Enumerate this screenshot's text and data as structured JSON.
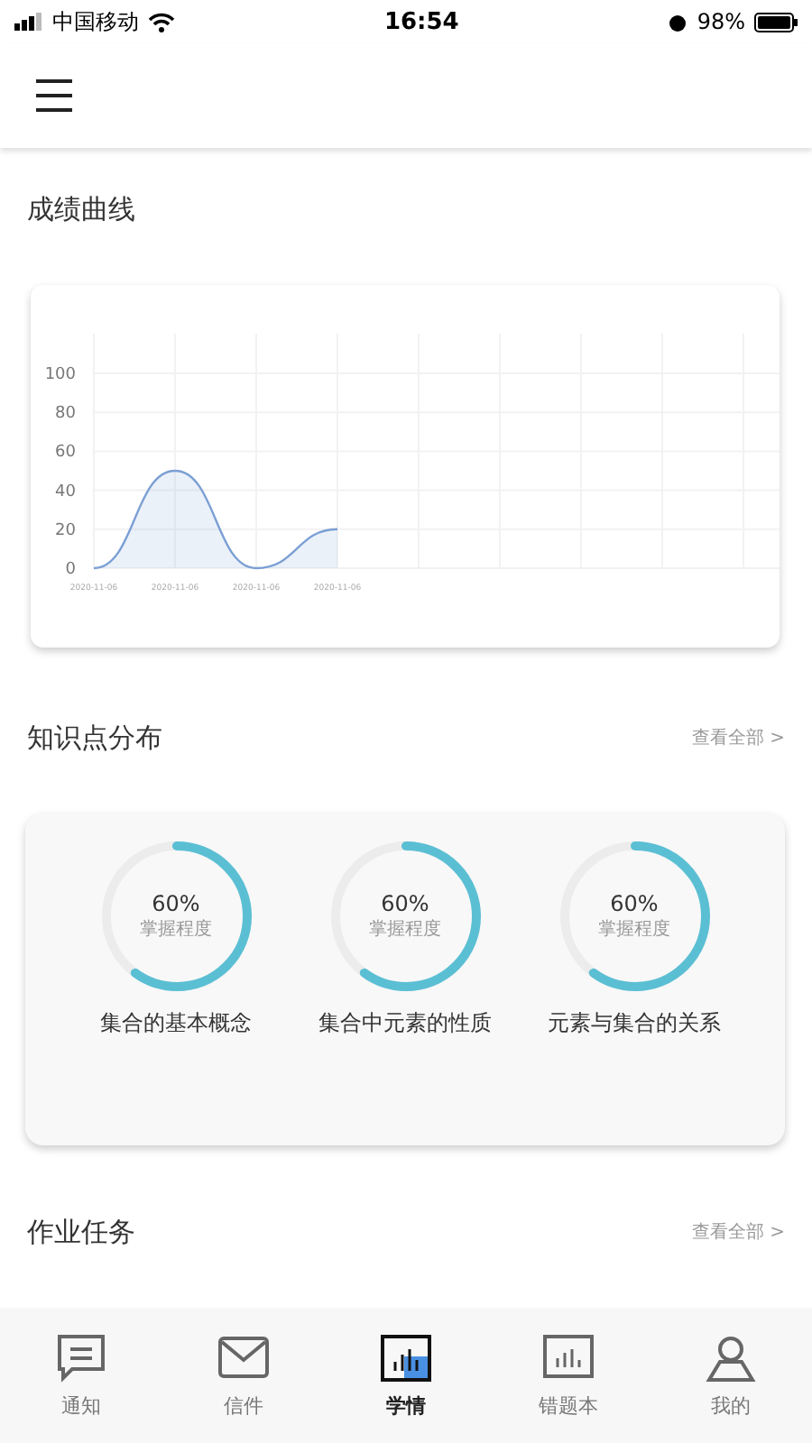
{
  "status_bar": {
    "carrier": "中国移动",
    "time": "16:54",
    "battery": "98%"
  },
  "score_section": {
    "title": "成绩曲线",
    "chart_data": {
      "type": "area",
      "categories": [
        "2020-11-06",
        "2020-11-06",
        "2020-11-06",
        "2020-11-06"
      ],
      "grid": true,
      "series": [
        {
          "color": "#7b9fd4",
          "values": [
            0,
            50,
            0,
            20
          ]
        }
      ],
      "ylim": [
        0,
        100
      ],
      "yticks": [
        0,
        20,
        40,
        60,
        80,
        100
      ]
    }
  },
  "knowledge_section": {
    "title": "知识点分布",
    "more": "查看全部 >",
    "items": [
      {
        "percent": "60%",
        "caption": "掌握程度",
        "name": "集合的基本概念",
        "level": 0.6
      },
      {
        "percent": "60%",
        "caption": "掌握程度",
        "name": "集合中元素的性质",
        "level": 0.6
      },
      {
        "percent": "60%",
        "caption": "掌握程度",
        "name": "元素与集合的关系",
        "level": 0.6
      }
    ]
  },
  "homework_section": {
    "title": "作业任务",
    "more": "查看全部 >"
  },
  "tab_bar": [
    {
      "label": "通知",
      "kind": "notice",
      "selected": false
    },
    {
      "label": "信件",
      "kind": "mail",
      "selected": false
    },
    {
      "label": "学情",
      "kind": "stats",
      "selected": true
    },
    {
      "label": "错题本",
      "kind": "mistakes",
      "selected": false
    },
    {
      "label": "我的",
      "kind": "me",
      "selected": false
    }
  ]
}
